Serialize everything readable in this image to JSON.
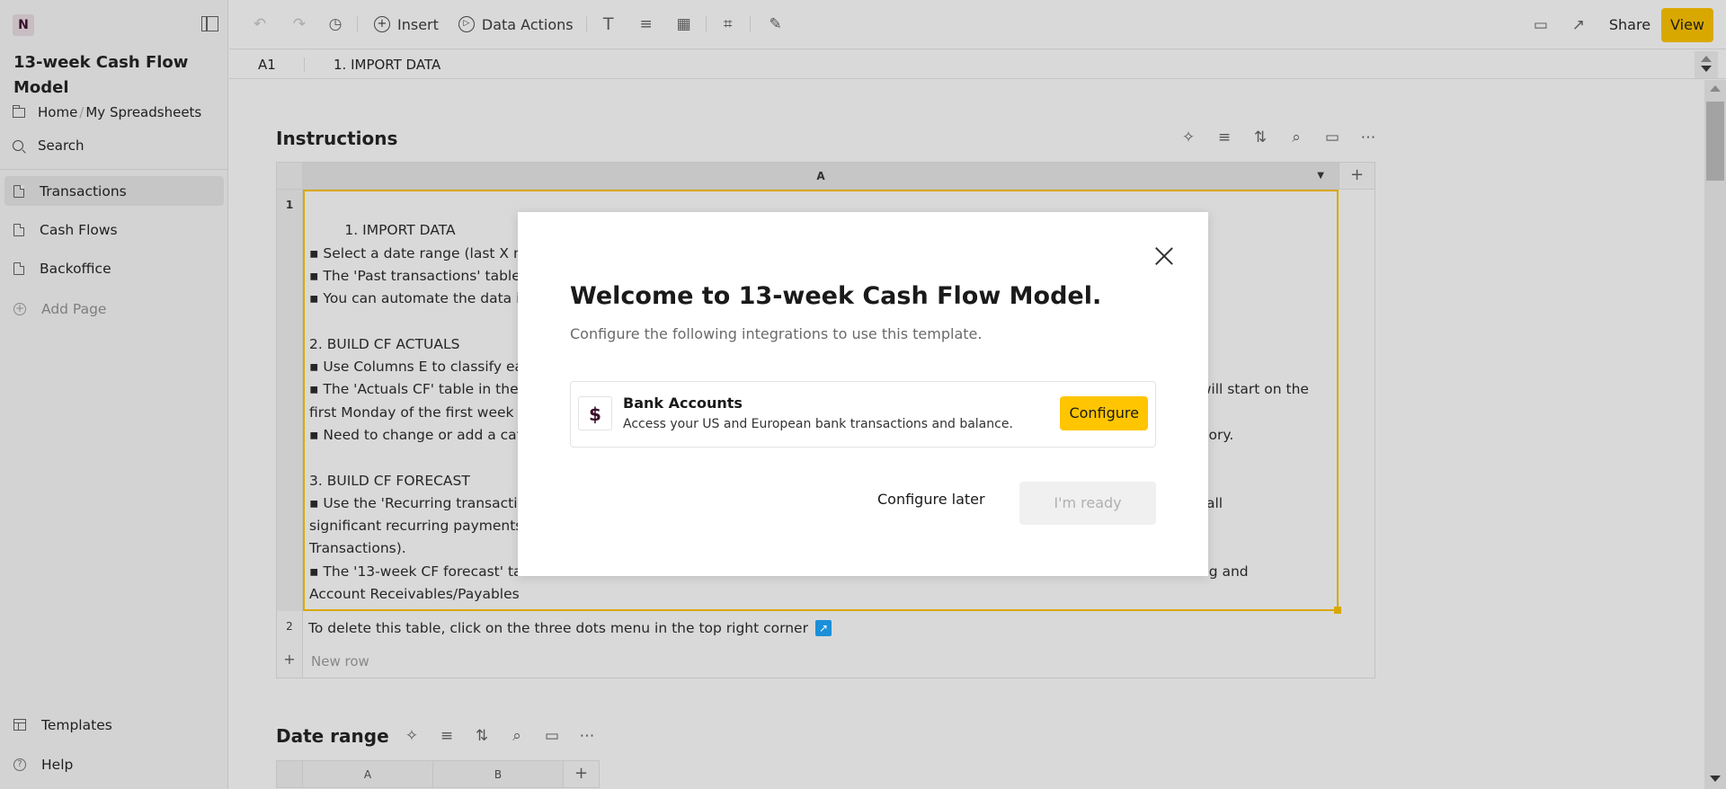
{
  "app": {
    "logo_letter": "N",
    "doc_title": "13-week Cash Flow Model"
  },
  "sidebar": {
    "breadcrumb": {
      "home": "Home",
      "separator": "/",
      "folder": "My Spreadsheets"
    },
    "search_label": "Search",
    "pages": [
      {
        "label": "Transactions",
        "active": true
      },
      {
        "label": "Cash Flows",
        "active": false
      },
      {
        "label": "Backoffice",
        "active": false
      }
    ],
    "add_page_label": "Add Page",
    "footer": [
      {
        "label": "Templates",
        "icon": "template-icon"
      },
      {
        "label": "Help",
        "icon": "help-icon"
      }
    ]
  },
  "toolbar": {
    "undo_icon": "↶",
    "redo_icon": "↷",
    "history_icon": "◷",
    "insert_label": "Insert",
    "data_actions_label": "Data Actions",
    "text_icon": "T",
    "align_icon": "≡",
    "format_icon": "▦",
    "number_format_icon": "⌗",
    "clear_format_icon": "✎",
    "comments_icon": "▭",
    "trend_icon": "↗",
    "share_label": "Share",
    "view_label": "View"
  },
  "formula_bar": {
    "cell_ref": "A1",
    "value": "1. IMPORT DATA"
  },
  "instructions_table": {
    "title": "Instructions",
    "tools": [
      "✧",
      "≡",
      "⇅",
      "⌕",
      "▭",
      "⋯"
    ],
    "column_header": "A",
    "add_column": "+",
    "rows": [
      {
        "num": "1",
        "text": "1. IMPORT DATA\n▪ Select a date range (last X m\n▪ The 'Past transactions' table\n▪ You can automate the data in\n\n2. BUILD CF ACTUALS\n▪ Use Columns E to classify eac\n▪ The 'Actuals CF' table in the '                                                                                                                                                        will start on the\nfirst Monday of the first week\n▪ Need to change or add a cate                                                                                                                                                  ategory.\n\n3. BUILD CF FORECAST\n▪ Use the 'Recurring transactio                                                                                                                                                tively all\nsignificant recurring payments                                                                                                                                               rring\nTransactions).\n▪ The '13-week CF forecast' ta                                                                                                                                              Recurring and\nAccount Receivables/Payables"
      },
      {
        "num": "2",
        "text": "To delete this table, click on the three dots menu in the top right corner",
        "link_icon": "↗"
      }
    ],
    "new_row_label": "New row",
    "new_row_icon": "+"
  },
  "date_range_table": {
    "title": "Date range",
    "tools": [
      "✧",
      "≡",
      "⇅",
      "⌕",
      "▭",
      "⋯"
    ],
    "columns": [
      "A",
      "B"
    ],
    "add_column": "+"
  },
  "modal": {
    "title": "Welcome to 13-week Cash Flow Model.",
    "subtitle": "Configure the following integrations to use this template.",
    "integration": {
      "icon": "$",
      "name": "Bank Accounts",
      "description": "Access your US and European bank transactions and balance.",
      "button_label": "Configure"
    },
    "configure_later_label": "Configure later",
    "ready_label": "I'm ready",
    "ready_disabled": true
  },
  "colors": {
    "accent": "#d9a800",
    "configure_button": "#ffc500",
    "link_icon": "#1b8fd8"
  }
}
